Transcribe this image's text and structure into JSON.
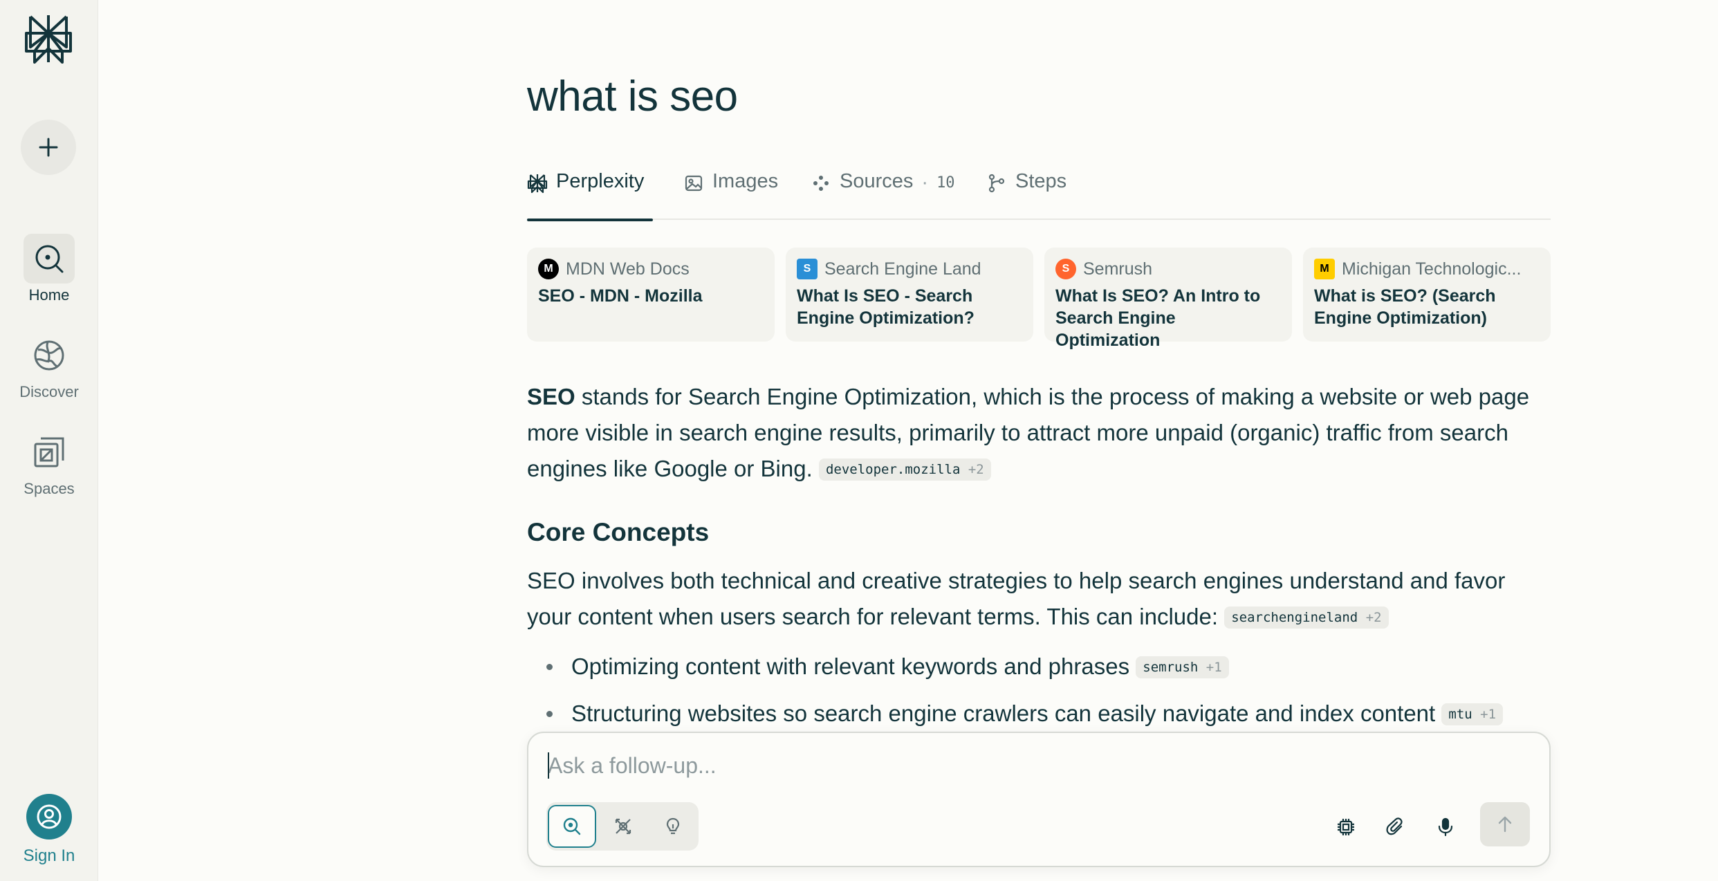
{
  "sidebar": {
    "nav": [
      {
        "label": "Home",
        "icon": "home-search-icon",
        "active": true
      },
      {
        "label": "Discover",
        "icon": "globe-icon",
        "active": false
      },
      {
        "label": "Spaces",
        "icon": "spaces-icon",
        "active": false
      }
    ],
    "sign_in_label": "Sign In"
  },
  "query": "what is seo",
  "tabs": [
    {
      "label": "Perplexity",
      "icon": "perplexity-icon",
      "active": true
    },
    {
      "label": "Images",
      "icon": "image-icon"
    },
    {
      "label": "Sources",
      "icon": "sources-icon",
      "count": "10"
    },
    {
      "label": "Steps",
      "icon": "steps-icon"
    }
  ],
  "sources": [
    {
      "site": "MDN Web Docs",
      "title": "SEO - MDN - Mozilla",
      "favicon_color": "#000000",
      "favicon_text": "M"
    },
    {
      "site": "Search Engine Land",
      "title": "What Is SEO - Search Engine Optimization?",
      "favicon_color": "#2a8fd6",
      "favicon_text": "S"
    },
    {
      "site": "Semrush",
      "title": "What Is SEO? An Intro to Search Engine Optimization",
      "favicon_color": "#ff642d",
      "favicon_text": "S"
    },
    {
      "site": "Michigan Technologic...",
      "title": "What is SEO? (Search Engine Optimization)",
      "favicon_color": "#ffcd00",
      "favicon_text": "M"
    }
  ],
  "answer": {
    "intro_bold": "SEO",
    "intro_rest": " stands for Search Engine Optimization, which is the process of making a website or web page more visible in search engine results, primarily to attract more unpaid (organic) traffic from search engines like Google or Bing.",
    "intro_cite": {
      "site": "developer.mozilla",
      "extra": "+2"
    },
    "heading": "Core Concepts",
    "para2": "SEO involves both technical and creative strategies to help search engines understand and favor your content when users search for relevant terms. This can include:",
    "para2_cite": {
      "site": "searchengineland",
      "extra": "+2"
    },
    "bullets": [
      {
        "text": "Optimizing content with relevant keywords and phrases",
        "cite": "semrush",
        "extra": "+1"
      },
      {
        "text": "Structuring websites so search engine crawlers can easily navigate and index content",
        "cite": "mtu",
        "extra": "+1"
      }
    ]
  },
  "composer": {
    "placeholder": "Ask a follow-up...",
    "modes": [
      "search-mode-icon",
      "research-mode-icon",
      "labs-mode-icon"
    ],
    "tools": [
      "model-chip-icon",
      "attach-icon",
      "microphone-icon"
    ],
    "send_icon": "arrow-up-icon"
  },
  "colors": {
    "accent": "#20808d",
    "text": "#13343b",
    "muted": "#5f6f73",
    "sidebar_bg": "#f3f3ee",
    "page_bg": "#fcfcf9"
  }
}
